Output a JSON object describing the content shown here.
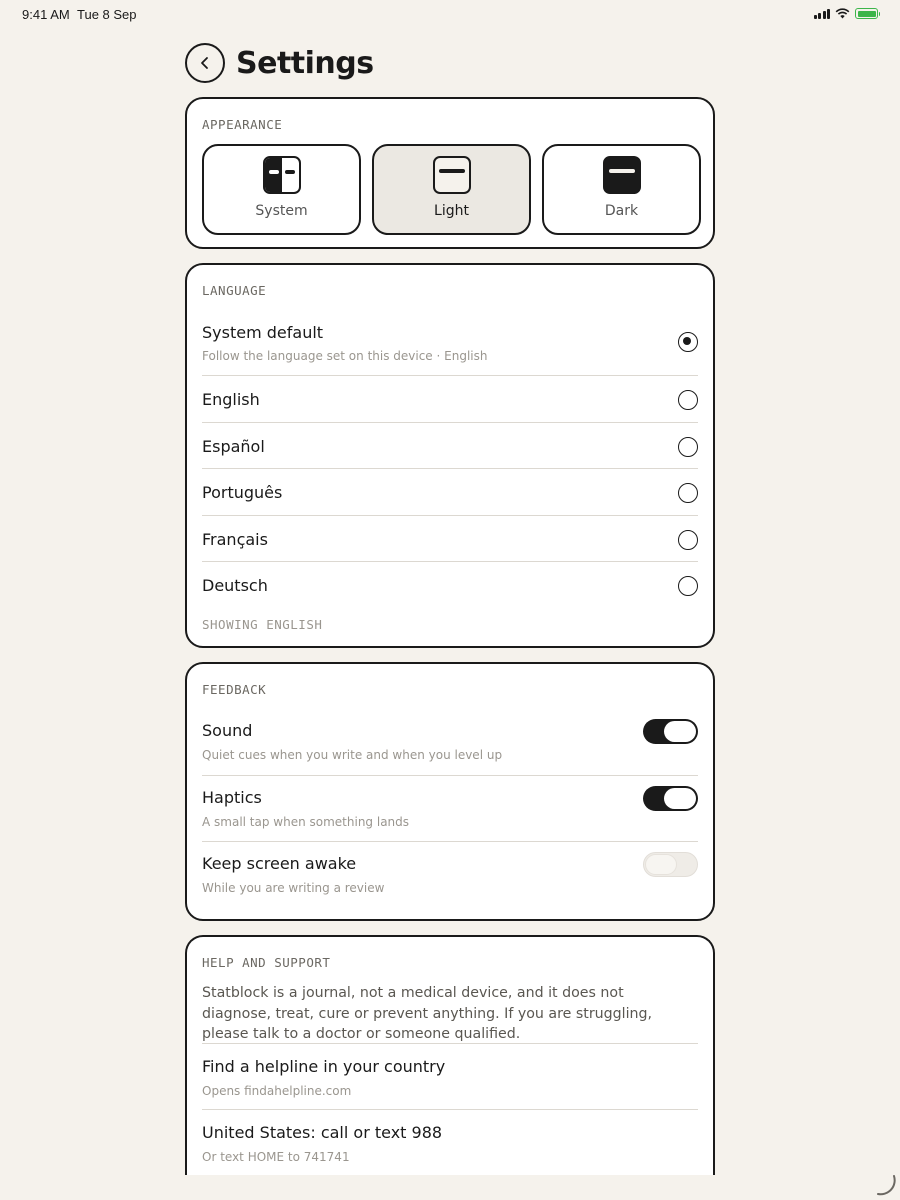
{
  "status": {
    "time": "9:41 AM",
    "date": "Tue 8 Sep"
  },
  "header": {
    "title": "Settings",
    "back_icon": "chevron-left-icon"
  },
  "appearance": {
    "label": "APPEARANCE",
    "options": [
      {
        "label": "System",
        "icon": "theme-system-icon",
        "selected": false
      },
      {
        "label": "Light",
        "icon": "theme-light-icon",
        "selected": true
      },
      {
        "label": "Dark",
        "icon": "theme-dark-icon",
        "selected": false
      }
    ]
  },
  "language": {
    "label": "LANGUAGE",
    "items": [
      {
        "name": "System default",
        "sub": "Follow the language set on this device · English",
        "selected": true
      },
      {
        "name": "English",
        "selected": false
      },
      {
        "name": "Español",
        "selected": false
      },
      {
        "name": "Português",
        "selected": false
      },
      {
        "name": "Français",
        "selected": false
      },
      {
        "name": "Deutsch",
        "selected": false
      }
    ],
    "showing": "SHOWING ENGLISH"
  },
  "feedback": {
    "label": "FEEDBACK",
    "items": [
      {
        "title": "Sound",
        "sub": "Quiet cues when you write and when you level up",
        "on": true
      },
      {
        "title": "Haptics",
        "sub": "A small tap when something lands",
        "on": true
      },
      {
        "title": "Keep screen awake",
        "sub": "While you are writing a review",
        "on": false
      }
    ]
  },
  "help": {
    "label": "HELP AND SUPPORT",
    "disclaimer": "Statblock is a journal, not a medical device, and it does not diagnose, treat, cure or prevent anything. If you are struggling, please talk to a doctor or someone qualified.",
    "items": [
      {
        "title": "Find a helpline in your country",
        "sub": "Opens findahelpline.com"
      },
      {
        "title": "United States: call or text 988",
        "sub": "Or text HOME to 741741"
      }
    ]
  },
  "colors": {
    "background": "#f5f2ec",
    "ink": "#1a1a1a",
    "battery": "#3cb54a",
    "selected_tile": "#ebe8e2"
  }
}
